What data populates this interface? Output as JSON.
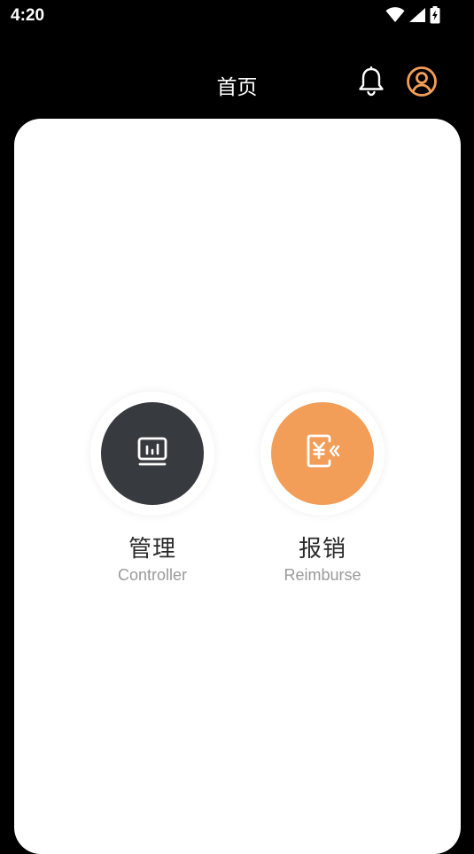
{
  "status_bar": {
    "time": "4:20",
    "icons": [
      "wifi-icon",
      "signal-icon",
      "battery-charging-icon"
    ]
  },
  "header": {
    "title": "首页",
    "icons": [
      "bell-icon",
      "user-profile-icon"
    ]
  },
  "colors": {
    "background": "#000000",
    "card": "#ffffff",
    "accent_orange": "#f29e59",
    "dark_circle": "#373a3e",
    "title_text": "#2b2b2b",
    "subtitle_text": "#9a9a9a"
  },
  "features": [
    {
      "title": "管理",
      "subtitle": "Controller",
      "icon": "dashboard-monitor-icon",
      "color": "#373a3e"
    },
    {
      "title": "报销",
      "subtitle": "Reimburse",
      "icon": "yuan-refund-icon",
      "color": "#f29e59"
    }
  ]
}
